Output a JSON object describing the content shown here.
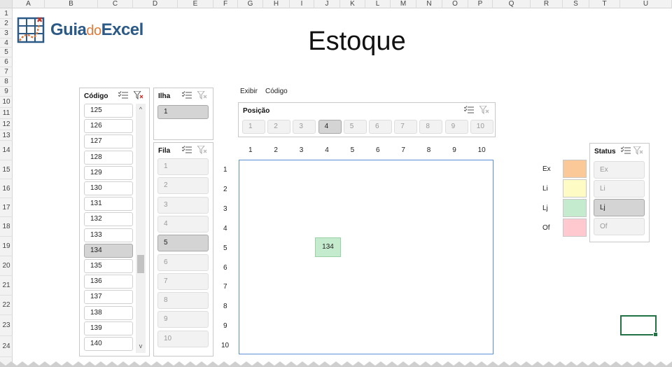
{
  "spreadsheet": {
    "columns": [
      "A",
      "B",
      "C",
      "D",
      "E",
      "F",
      "G",
      "H",
      "I",
      "J",
      "K",
      "L",
      "M",
      "N",
      "O",
      "P",
      "Q",
      "R",
      "S",
      "T",
      "U"
    ],
    "rows": [
      "1",
      "2",
      "3",
      "4",
      "5",
      "6",
      "7",
      "8",
      "9",
      "10",
      "11",
      "12",
      "13",
      "14",
      "15",
      "16",
      "17",
      "18",
      "19",
      "20",
      "21",
      "22",
      "23",
      "24"
    ]
  },
  "logo": {
    "part1": "Guia",
    "part2": "do",
    "part3": "Excel"
  },
  "page_title": "Estoque",
  "slicer_codigo": {
    "title": "Código",
    "items": [
      "125",
      "126",
      "127",
      "128",
      "129",
      "130",
      "131",
      "132",
      "133",
      "134",
      "135",
      "136",
      "137",
      "138",
      "139",
      "140"
    ],
    "selected": "134",
    "scroll_up": "^",
    "scroll_down": "v"
  },
  "slicer_ilha": {
    "title": "Ilha",
    "items": [
      "1"
    ],
    "selected": "1"
  },
  "slicer_fila": {
    "title": "Fila",
    "items": [
      "1",
      "2",
      "3",
      "4",
      "5",
      "6",
      "7",
      "8",
      "9",
      "10"
    ],
    "selected": "5"
  },
  "labels": {
    "exibir": "Exibir",
    "codigo": "Código"
  },
  "slicer_posicao": {
    "title": "Posição",
    "items": [
      "1",
      "2",
      "3",
      "4",
      "5",
      "6",
      "7",
      "8",
      "9",
      "10"
    ],
    "selected": "4"
  },
  "grid": {
    "col_numbers": [
      "1",
      "2",
      "3",
      "4",
      "5",
      "6",
      "7",
      "8",
      "9",
      "10"
    ],
    "row_numbers": [
      "1",
      "2",
      "3",
      "4",
      "5",
      "6",
      "7",
      "8",
      "9",
      "10"
    ],
    "placed_item": {
      "code": "134",
      "col": 4,
      "row": 5,
      "color": "#c5ebce"
    }
  },
  "legend": [
    {
      "label": "Ex",
      "color": "#fbc998"
    },
    {
      "label": "Li",
      "color": "#fefcc4"
    },
    {
      "label": "Lj",
      "color": "#c5ebce"
    },
    {
      "label": "Of",
      "color": "#ffc9cf"
    }
  ],
  "slicer_status": {
    "title": "Status",
    "items": [
      "Ex",
      "Li",
      "Lj",
      "Of"
    ],
    "selected": "Lj"
  }
}
